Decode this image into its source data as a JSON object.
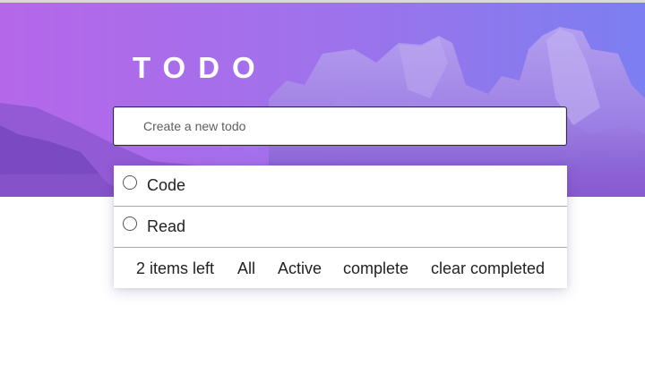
{
  "app": {
    "title": "TODO"
  },
  "colors": {
    "hero_start": "#b065ea",
    "hero_end": "#7a7df0",
    "text": "#222222",
    "border": "#a8a8b0"
  },
  "icons": {
    "theme_toggle": "moon-icon",
    "todo_check": "circle-outline"
  },
  "new_todo": {
    "placeholder": "Create a new todo",
    "value": ""
  },
  "todos": [
    {
      "text": "Code",
      "completed": false
    },
    {
      "text": "Read",
      "completed": false
    }
  ],
  "footer": {
    "items_left": "2 items left",
    "filter_all": "All",
    "filter_active": "Active",
    "filter_complete": "complete",
    "clear_completed": "clear completed"
  }
}
